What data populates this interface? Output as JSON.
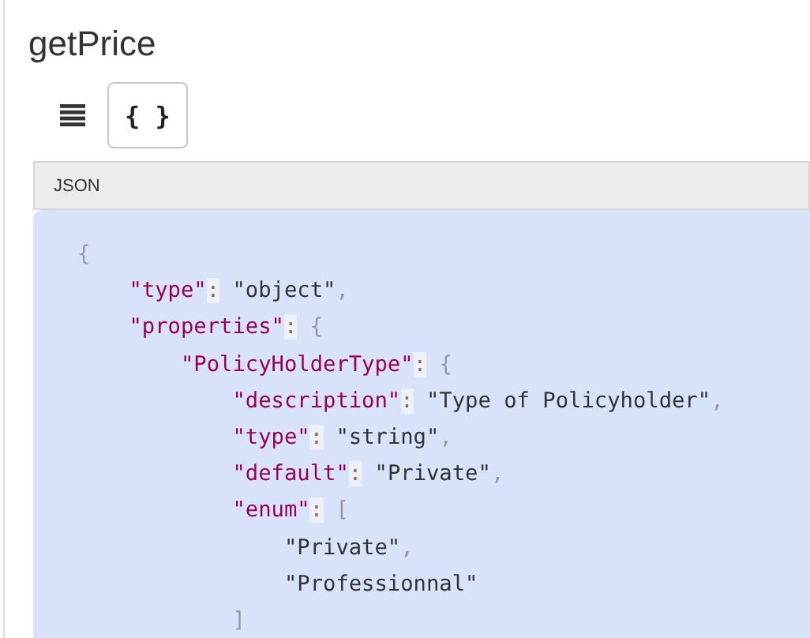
{
  "title": "getPrice",
  "views": [
    {
      "kind": "list",
      "selected": false
    },
    {
      "kind": "json",
      "label": "{ }",
      "selected": true
    }
  ],
  "panel": {
    "header": "JSON",
    "code_lines": [
      "{",
      "    \"type\": \"object\",",
      "    \"properties\": {",
      "        \"PolicyHolderType\": {",
      "            \"description\": \"Type of Policyholder\",",
      "            \"type\": \"string\",",
      "            \"default\": \"Private\",",
      "            \"enum\": [",
      "                \"Private\",",
      "                \"Professionnal\"",
      "            ]"
    ]
  }
}
